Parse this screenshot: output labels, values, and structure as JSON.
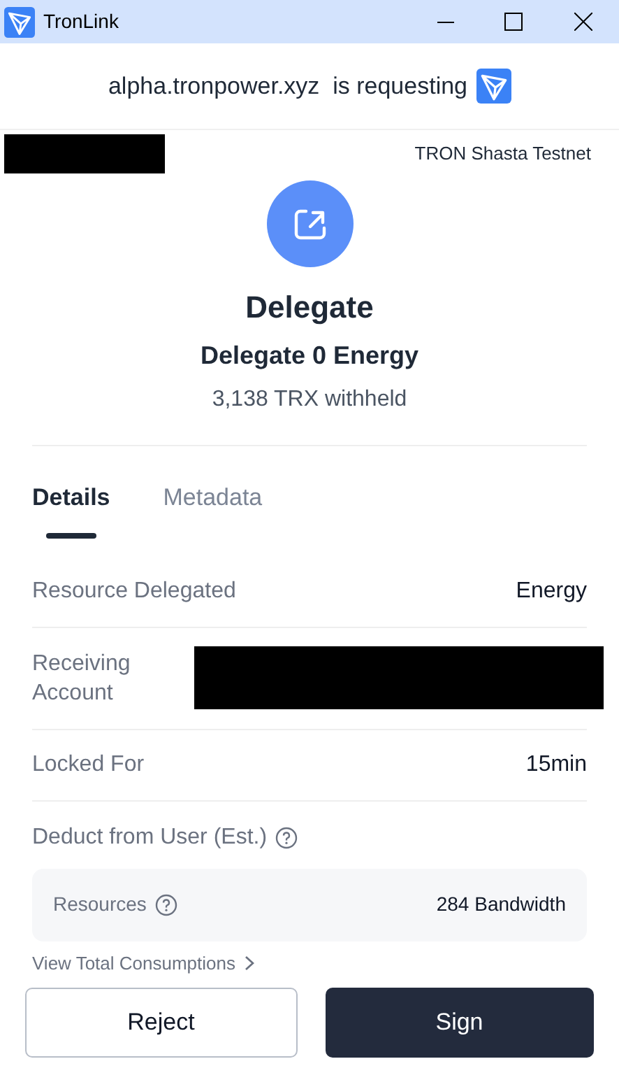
{
  "window": {
    "title": "TronLink"
  },
  "request": {
    "origin": "alpha.tronpower.xyz",
    "text": "is requesting"
  },
  "network": "TRON Shasta Testnet",
  "action": {
    "title": "Delegate",
    "subtitle": "Delegate 0 Energy",
    "note": "3,138 TRX withheld"
  },
  "tabs": [
    {
      "label": "Details",
      "selected": true
    },
    {
      "label": "Metadata",
      "selected": false
    }
  ],
  "details": [
    {
      "kind": "text",
      "label": "Resource Delegated",
      "value": "Energy"
    },
    {
      "kind": "redacted",
      "label": "Receiving Account"
    },
    {
      "kind": "text",
      "label": "Locked For",
      "value": "15min"
    }
  ],
  "deduct": {
    "label": "Deduct from User (Est.)",
    "resources_label": "Resources",
    "resources_value": "284 Bandwidth"
  },
  "view_total": "View Total Consumptions",
  "buttons": {
    "reject": "Reject",
    "sign": "Sign"
  }
}
